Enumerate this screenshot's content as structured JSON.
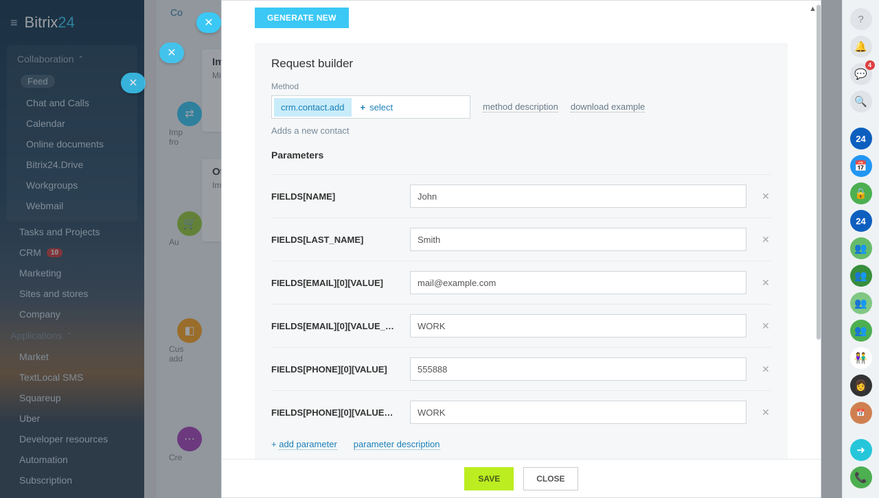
{
  "brand": {
    "name": "Bitrix",
    "suffix": "24"
  },
  "nav": {
    "sections": [
      {
        "label": "Collaboration"
      },
      {
        "label": "Applications"
      }
    ],
    "items": {
      "feed": "Feed",
      "chat": "Chat and Calls",
      "calendar": "Calendar",
      "docs": "Online documents",
      "drive": "Bitrix24.Drive",
      "workgroups": "Workgroups",
      "webmail": "Webmail",
      "tasks": "Tasks and Projects",
      "crm": "CRM",
      "crm_badge": "10",
      "marketing": "Marketing",
      "sites": "Sites and stores",
      "company": "Company",
      "market": "Market",
      "textlocal": "TextLocal SMS",
      "squareup": "Squareup",
      "uber": "Uber",
      "devres": "Developer resources",
      "automation": "Automation",
      "subscription": "Subscription"
    }
  },
  "back": {
    "tab": "Co",
    "card1": {
      "title": "Im",
      "sub": "Mig",
      "icon_sub": "Imp\nfro"
    },
    "card2": {
      "title": "Ot",
      "sub": "Imp",
      "icon_sub": "Au"
    },
    "card3": {
      "icon_sub": "Cus\nadd"
    },
    "card4": {
      "icon_sub": "Cre"
    }
  },
  "modal": {
    "generate_btn": "GENERATE NEW",
    "panel_title": "Request builder",
    "method_label": "Method",
    "method_name": "crm.contact.add",
    "method_select": "select",
    "link_method_desc": "method description",
    "link_download": "download example",
    "method_desc": "Adds a new contact",
    "params_title": "Parameters",
    "params": [
      {
        "label": "FIELDS[NAME]",
        "value": "John"
      },
      {
        "label": "FIELDS[LAST_NAME]",
        "value": "Smith"
      },
      {
        "label": "FIELDS[EMAIL][0][VALUE]",
        "value": "mail@example.com"
      },
      {
        "label": "FIELDS[EMAIL][0][VALUE_…",
        "value": "WORK"
      },
      {
        "label": "FIELDS[PHONE][0][VALUE]",
        "value": "555888"
      },
      {
        "label": "FIELDS[PHONE][0][VALUE…",
        "value": "WORK"
      }
    ],
    "add_param": "add parameter",
    "param_desc_link": "parameter description",
    "save": "SAVE",
    "close": "CLOSE"
  },
  "rail": {
    "badge": "4",
    "b24": "24"
  }
}
